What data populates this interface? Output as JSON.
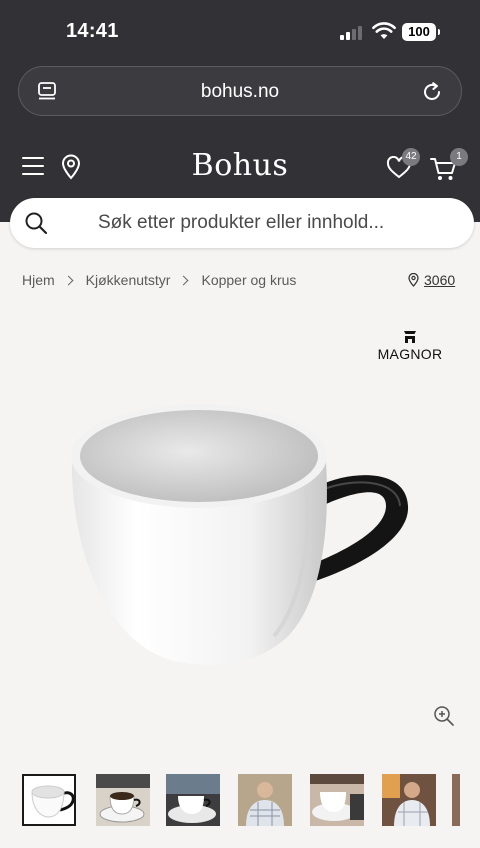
{
  "status_bar": {
    "time": "14:41",
    "battery": "100"
  },
  "browser": {
    "url": "bohus.no"
  },
  "header": {
    "logo": "Bohus",
    "wishlist_count": "42",
    "cart_count": "1"
  },
  "search": {
    "placeholder": "Søk etter produkter eller innhold..."
  },
  "breadcrumb": {
    "items": [
      "Hjem",
      "Kjøkkenutstyr",
      "Kopper og krus"
    ]
  },
  "store": {
    "code": "3060"
  },
  "product": {
    "brand": "MAGNOR"
  },
  "colors": {
    "header_bg": "#323236",
    "page_bg": "#f5f4f2",
    "badge_bg": "#7b7b7f"
  },
  "icons": [
    "tabs-icon",
    "reload-icon",
    "menu-icon",
    "location-pin-icon",
    "heart-icon",
    "cart-icon",
    "search-icon",
    "zoom-in-icon"
  ]
}
